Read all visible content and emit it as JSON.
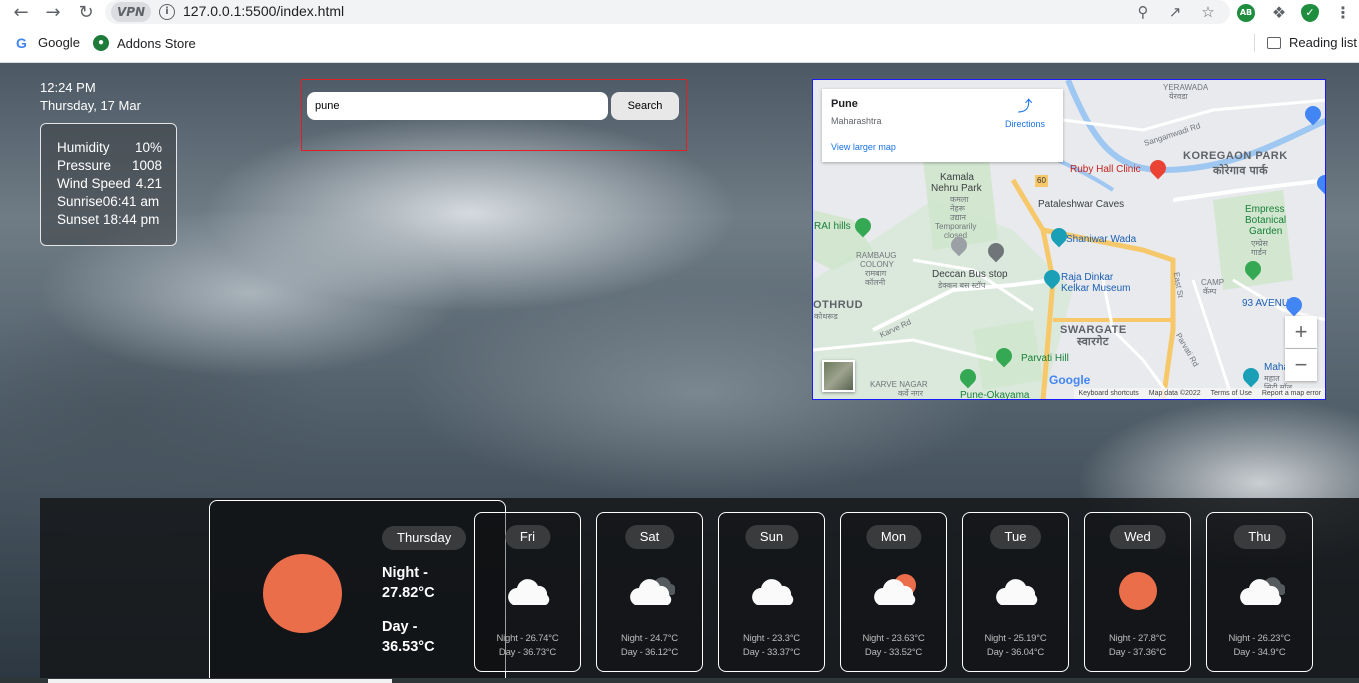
{
  "browser": {
    "vpn_label": "VPN",
    "url": "127.0.0.1:5500/index.html",
    "bookmarks": [
      {
        "label": "Google",
        "icon": "google-icon"
      },
      {
        "label": "Addons Store",
        "icon": "addons-store-icon"
      }
    ],
    "reading_list": "Reading list",
    "extensions": {
      "ab": "AB"
    }
  },
  "weather": {
    "time": "12:24 PM",
    "date": "Thursday, 17 Mar",
    "stats": [
      {
        "label": "Humidity",
        "value": "10%"
      },
      {
        "label": "Pressure",
        "value": "1008"
      },
      {
        "label": "Wind Speed",
        "value": "4.21"
      },
      {
        "label": "Sunrise",
        "value": "06:41 am"
      },
      {
        "label": "Sunset",
        "value": "18:44 pm"
      }
    ]
  },
  "search": {
    "value": "pune",
    "button": "Search"
  },
  "map": {
    "place": "Pune",
    "region": "Maharashtra",
    "directions": "Directions",
    "view_larger": "View larger map",
    "labels": {
      "koregaon": "KOREGAON PARK",
      "koregaon_local": "कोरेगाव पार्क",
      "ruby": "Ruby Hall Clinic",
      "kamala": "Kamala",
      "nehru": "Nehru Park",
      "kamala_local": "कमला",
      "nehru_local": "नेहरू",
      "udyan": "उद्यान",
      "temp": "Temporarily",
      "closed": "closed",
      "pataleshwar": "Pataleshwar Caves",
      "shaniwar": "Shaniwar Wada",
      "empress1": "Empress",
      "empress2": "Botanical",
      "empress3": "Garden",
      "empress_local1": "एम्प्रेस",
      "empress_local2": "गार्डन",
      "rai": "RAI hills",
      "rambaug": "RAMBAUG",
      "colony": "COLONY",
      "rambaug_local": "रामबाग",
      "colony_local": "कॉलनी",
      "deccan": "Deccan Bus stop",
      "deccan_local": "डेक्कन बस स्टॉप",
      "raja1": "Raja Dinkar",
      "raja2": "Kelkar Museum",
      "camp": "CAMP",
      "camp_local": "कॅम्प",
      "avenue": "93 AVENUE",
      "kothrud": "OTHRUD",
      "kothrud_local": "कोथरूड",
      "swargate": "SWARGATE",
      "swargate_local": "स्वारगेट",
      "parvati": "Parvati Hill",
      "karve": "KARVE NAGAR",
      "karve_local": "कर्वे नगर",
      "okayama": "Pune-Okayama",
      "yerawada": "YERAWADA",
      "yerawada_local": "येरवडा",
      "sangamwadi": "Sangamwadi Rd",
      "karve_rd": "Karve Rd",
      "parvati_rd": "Parvati Rd",
      "east_st": "East St",
      "mahat": "Maha",
      "mahat_local1": "महात",
      "mahat_local2": "सिटी मॉल",
      "road_60": "60"
    },
    "google": "Google",
    "footer": [
      "Keyboard shortcuts",
      "Map data ©2022",
      "Terms of Use",
      "Report a map error"
    ]
  },
  "forecast": {
    "today": {
      "day": "Thursday",
      "night_label": "Night -",
      "night": "27.82°C",
      "day_label": "Day -",
      "day_temp": "36.53°C"
    },
    "days": [
      {
        "day": "Fri",
        "icon": "cloud",
        "night": "Night - 26.74°C",
        "dayt": "Day - 36.73°C"
      },
      {
        "day": "Sat",
        "icon": "cloud-dark",
        "night": "Night - 24.7°C",
        "dayt": "Day - 36.12°C"
      },
      {
        "day": "Sun",
        "icon": "cloud",
        "night": "Night - 23.3°C",
        "dayt": "Day - 33.37°C"
      },
      {
        "day": "Mon",
        "icon": "sun-cloud",
        "night": "Night - 23.63°C",
        "dayt": "Day - 33.52°C"
      },
      {
        "day": "Tue",
        "icon": "cloud",
        "night": "Night - 25.19°C",
        "dayt": "Day - 36.04°C"
      },
      {
        "day": "Wed",
        "icon": "sun",
        "night": "Night - 27.8°C",
        "dayt": "Day - 37.36°C"
      },
      {
        "day": "Thu",
        "icon": "cloud-dark",
        "night": "Night - 26.23°C",
        "dayt": "Day - 34.9°C"
      }
    ]
  },
  "colors": {
    "sun": "#eb6e4b",
    "search_border": "#e02020",
    "map_border": "#1a1aff"
  }
}
